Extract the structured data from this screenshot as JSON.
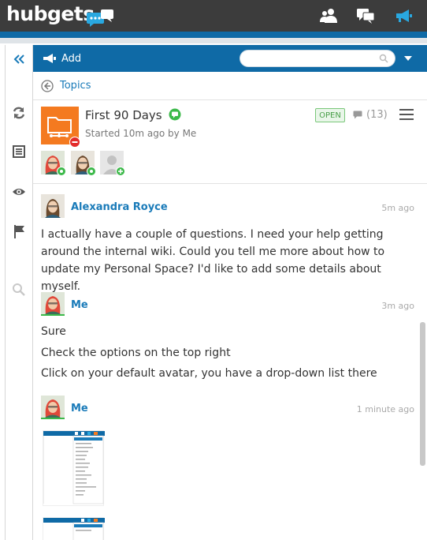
{
  "app": {
    "logo": "hubgets"
  },
  "toolbar": {
    "add_label": "Add",
    "search_placeholder": ""
  },
  "breadcrumb": {
    "label": "Topics"
  },
  "topic": {
    "title": "First 90 Days",
    "subtitle": "Started 10m ago by Me",
    "status": "OPEN",
    "comment_count": "(13)"
  },
  "messages": [
    {
      "author": "Alexandra Royce",
      "time": "5m ago",
      "lines": [
        "I actually have a couple of questions. I need your help getting around the internal wiki. Could you tell me more about how to update my Personal Space? I'd like to add some details about myself."
      ]
    },
    {
      "author": "Me",
      "time": "3m ago",
      "lines": [
        "Sure",
        "Check the options on the top right",
        "Click on your default avatar, you have a drop-down list there"
      ]
    },
    {
      "author": "Me",
      "time": "1 minute ago",
      "lines": []
    }
  ],
  "colors": {
    "brand_blue": "#0f6aa6",
    "link_blue": "#1a7bb9",
    "topbar": "#3c3c3c",
    "folder_orange": "#f47a20",
    "status_green": "#4aa04a",
    "accent_cyan": "#29a8e0"
  },
  "icons": {
    "topbar": [
      "contacts-icon",
      "chat-icon",
      "megaphone-icon"
    ],
    "rail": [
      "collapse-icon",
      "sync-icon",
      "list-icon",
      "eye-icon",
      "flag-icon",
      "search-icon"
    ]
  }
}
